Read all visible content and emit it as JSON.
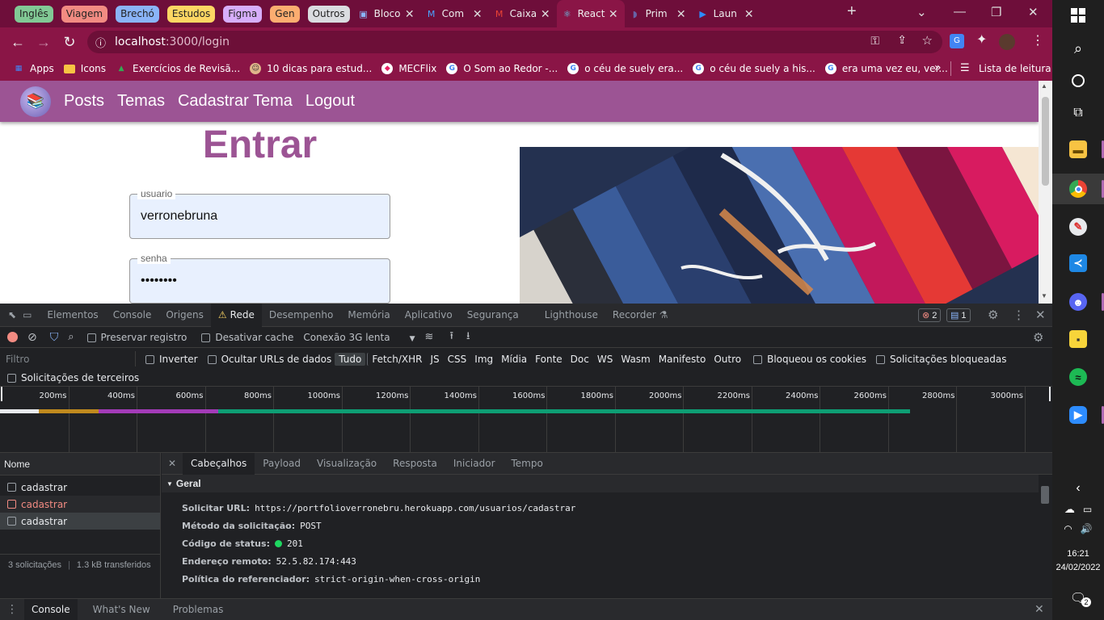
{
  "browser": {
    "tab_groups": [
      {
        "label": "Inglês",
        "color": "#81c995"
      },
      {
        "label": "Viagem",
        "color": "#f28b82"
      },
      {
        "label": "Brechó",
        "color": "#8ab4f8"
      },
      {
        "label": "Estudos",
        "color": "#fdd663"
      },
      {
        "label": "Figma",
        "color": "#d7aefb"
      },
      {
        "label": "Gen",
        "color": "#fcad70"
      },
      {
        "label": "Outros",
        "color": "#dadce0"
      }
    ],
    "tabs": [
      {
        "label": "Bloco",
        "icon": "document-icon",
        "active": false
      },
      {
        "label": "Com",
        "icon": "trello-icon",
        "active": false
      },
      {
        "label": "Caixa",
        "icon": "gmail-icon",
        "active": false
      },
      {
        "label": "React",
        "icon": "react-icon",
        "active": true
      },
      {
        "label": "Prim",
        "icon": "heroku-icon",
        "active": false
      },
      {
        "label": "Laun",
        "icon": "zoom-icon",
        "active": false
      }
    ],
    "new_tab": "+",
    "window_controls": {
      "dropdown": "⌄",
      "minimize": "—",
      "restore": "❐",
      "close": "✕"
    },
    "url": {
      "host": "localhost",
      "rest": ":3000/login"
    },
    "bookmarks": [
      {
        "label": "Apps",
        "icon": "apps-icon"
      },
      {
        "label": "Icons",
        "icon": "folder-icon"
      },
      {
        "label": "Exercícios de Revisã...",
        "icon": "drive-icon"
      },
      {
        "label": "10 dicas para estud...",
        "icon": "avatar-icon"
      },
      {
        "label": "MECFlix",
        "icon": "mecflix-icon"
      },
      {
        "label": "O Som ao Redor -...",
        "icon": "google-icon"
      },
      {
        "label": "o céu de suely era...",
        "icon": "google-icon"
      },
      {
        "label": "o céu de suely a his...",
        "icon": "google-icon"
      },
      {
        "label": "era uma vez eu, ver...",
        "icon": "google-icon"
      }
    ],
    "bookmarks_more": "»",
    "reading_list": "Lista de leitura"
  },
  "app": {
    "nav": [
      "Posts",
      "Temas",
      "Cadastrar Tema",
      "Logout"
    ],
    "title": "Entrar",
    "fields": [
      {
        "label": "usuario",
        "value": "verronebruna"
      },
      {
        "label": "senha",
        "value": "••••••••"
      }
    ]
  },
  "devtools": {
    "tabs": [
      "Elementos",
      "Console",
      "Origens",
      "Rede",
      "Desempenho",
      "Memória",
      "Aplicativo",
      "Segurança",
      "Lighthouse",
      "Recorder"
    ],
    "active_tab": "Rede",
    "errors_count": "2",
    "messages_count": "1",
    "network_toolbar": {
      "preserve_log": "Preservar registro",
      "disable_cache": "Desativar cache",
      "throttling": "Conexão 3G lenta"
    },
    "filter": {
      "placeholder": "Filtro",
      "invert": "Inverter",
      "hide_data_urls": "Ocultar URLs de dados",
      "types": [
        "Tudo",
        "Fetch/XHR",
        "JS",
        "CSS",
        "Img",
        "Mídia",
        "Fonte",
        "Doc",
        "WS",
        "Wasm",
        "Manifesto",
        "Outro"
      ],
      "active_type": "Tudo",
      "blocked_cookies": "Bloqueou os cookies",
      "blocked_requests": "Solicitações bloqueadas",
      "third_party": "Solicitações de terceiros"
    },
    "timeline_ticks": [
      "200ms",
      "400ms",
      "600ms",
      "800ms",
      "1000ms",
      "1200ms",
      "1400ms",
      "1600ms",
      "1800ms",
      "2000ms",
      "2200ms",
      "2400ms",
      "2600ms",
      "2800ms",
      "3000ms"
    ],
    "requests_header": "Nome",
    "requests": [
      {
        "name": "cadastrar",
        "status": "normal"
      },
      {
        "name": "cadastrar",
        "status": "error"
      },
      {
        "name": "cadastrar",
        "status": "selected"
      }
    ],
    "summary": {
      "count": "3 solicitações",
      "transferred": "1.3 kB transferidos"
    },
    "detail_tabs": [
      "Cabeçalhos",
      "Payload",
      "Visualização",
      "Resposta",
      "Iniciador",
      "Tempo"
    ],
    "active_detail_tab": "Cabeçalhos",
    "section_title": "Geral",
    "headers": [
      {
        "key": "Solicitar URL:",
        "value": "https://portfolioverronebru.herokuapp.com/usuarios/cadastrar"
      },
      {
        "key": "Método da solicitação:",
        "value": "POST"
      },
      {
        "key": "Código de status:",
        "value": "201"
      },
      {
        "key": "Endereço remoto:",
        "value": "52.5.82.174:443"
      },
      {
        "key": "Política do referenciador:",
        "value": "strict-origin-when-cross-origin"
      }
    ],
    "drawer_tabs": [
      "Console",
      "What's New",
      "Problemas"
    ],
    "active_drawer_tab": "Console"
  },
  "taskbar": {
    "time": "16:21",
    "date": "24/02/2022",
    "notifications": "2"
  }
}
